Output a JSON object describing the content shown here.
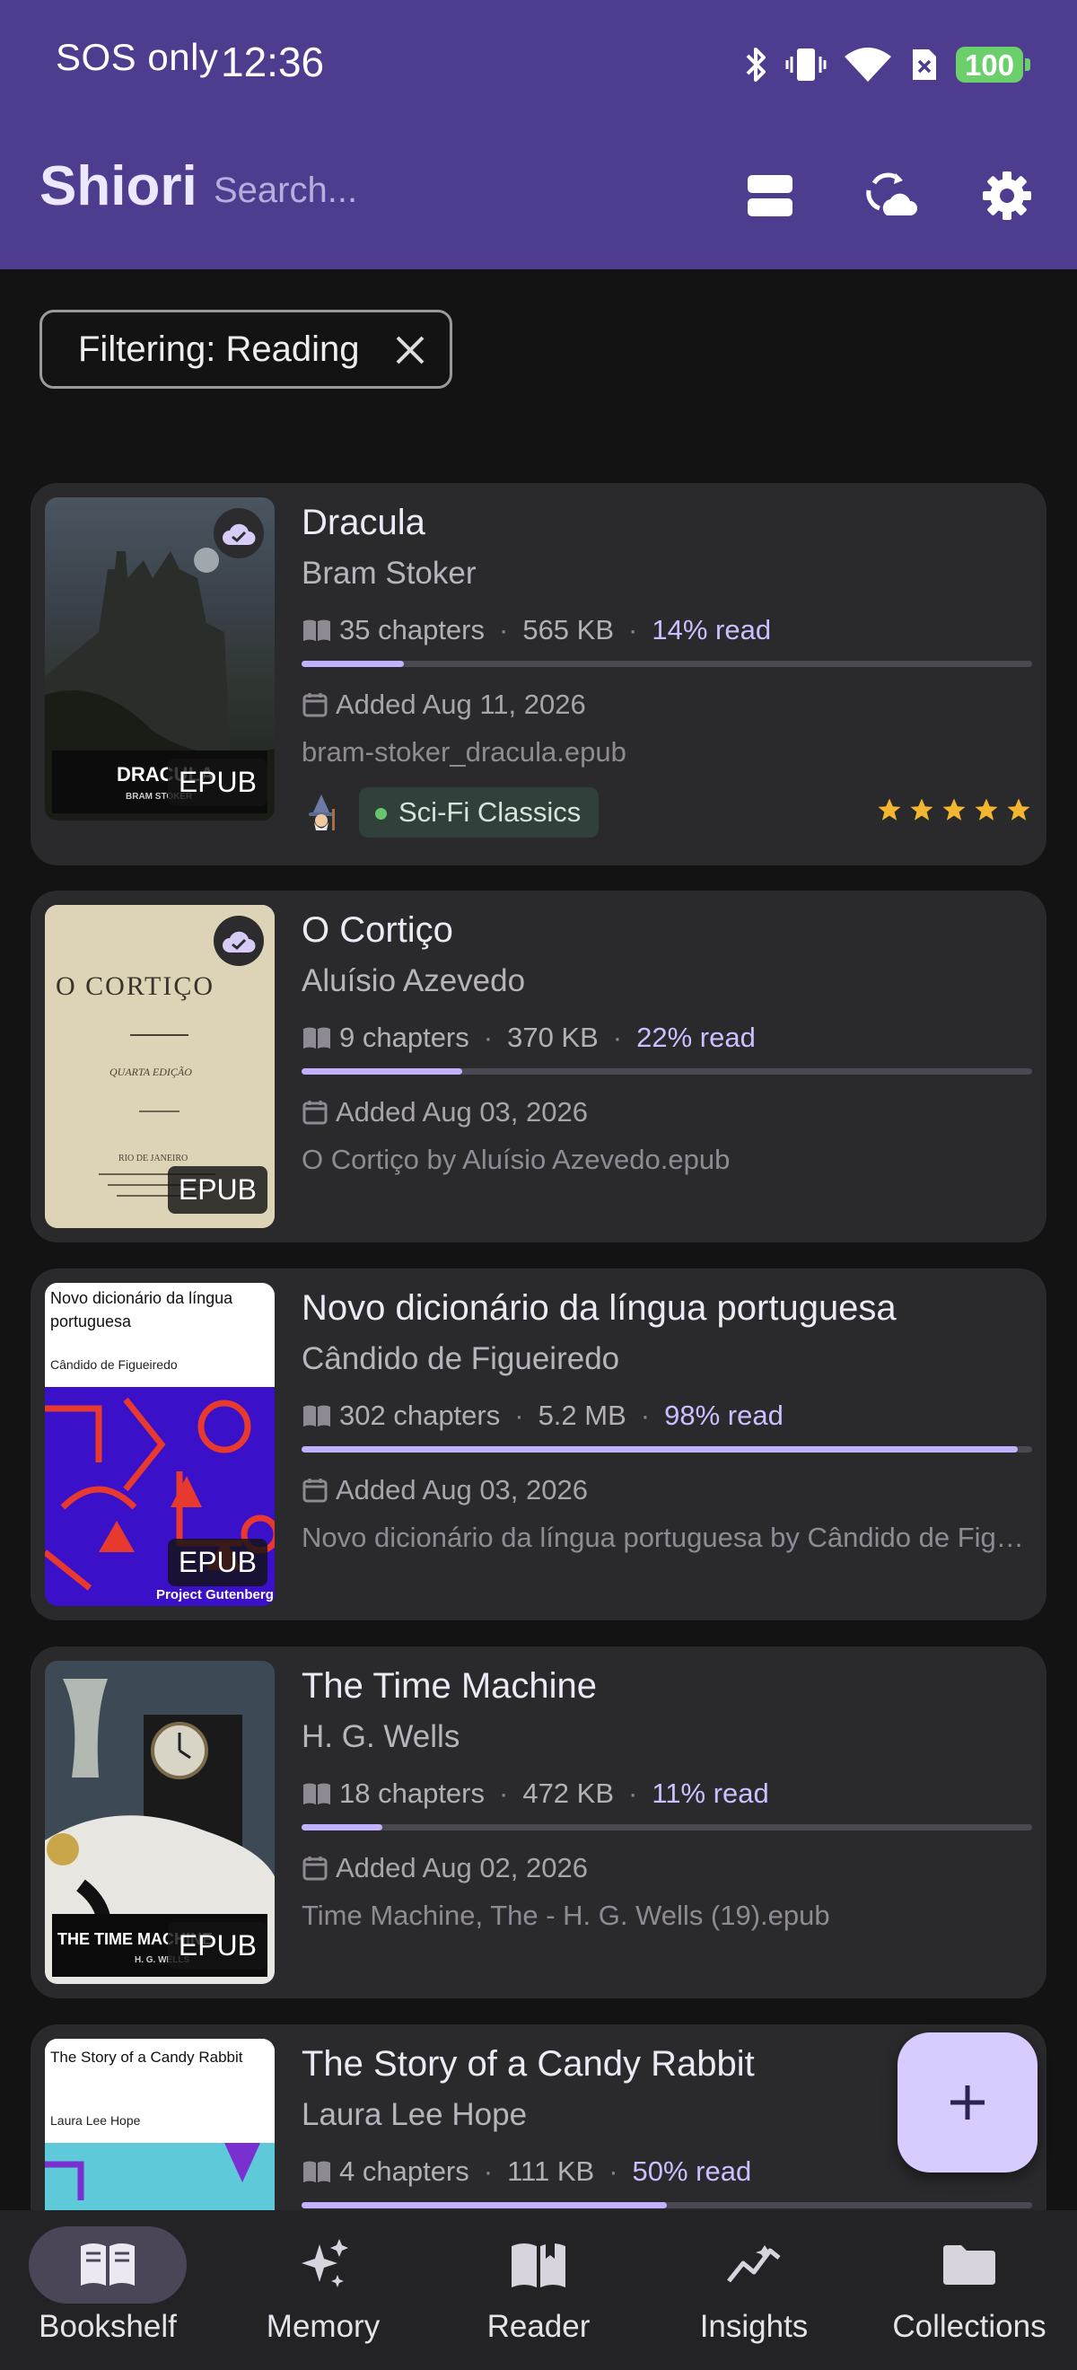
{
  "status": {
    "carrier": "SOS only",
    "time": "12:36",
    "battery": "100"
  },
  "appbar": {
    "title": "Shiori",
    "search_placeholder": "Search..."
  },
  "filter": {
    "label": "Filtering: Reading"
  },
  "books": [
    {
      "title": "Dracula",
      "author": "Bram Stoker",
      "chapters": "35 chapters",
      "size": "565 KB",
      "read": "14% read",
      "progress": 0.14,
      "added": "Added Aug 11, 2026",
      "file": "bram-stoker_dracula.epub",
      "format": "EPUB",
      "synced": true,
      "cover_title": "DRACULA",
      "cover_author": "BRAM STOKER",
      "tag": "Sci-Fi Classics",
      "rating": 5
    },
    {
      "title": "O Cortiço",
      "author": "Aluísio Azevedo",
      "chapters": "9 chapters",
      "size": "370 KB",
      "read": "22% read",
      "progress": 0.22,
      "added": "Added Aug 03, 2026",
      "file": "O Cortiço by Aluísio Azevedo.epub",
      "format": "EPUB",
      "synced": true,
      "cover_title": "O CORTIÇO",
      "cover_sub": "QUARTA EDIÇÃO",
      "cover_place": "RIO DE JANEIRO"
    },
    {
      "title": "Novo dicionário da língua portuguesa",
      "author": "Cândido de Figueiredo",
      "chapters": "302 chapters",
      "size": "5.2 MB",
      "read": "98% read",
      "progress": 0.98,
      "added": "Added Aug 03, 2026",
      "file": "Novo dicionário da língua portuguesa by Cândido de Figueiredo.epub",
      "format": "EPUB",
      "cover_title": "Novo dicionário da língua portuguesa",
      "cover_author": "Cândido de Figueiredo",
      "cover_publisher": "Project Gutenberg"
    },
    {
      "title": "The Time Machine",
      "author": "H. G. Wells",
      "chapters": "18 chapters",
      "size": "472 KB",
      "read": "11% read",
      "progress": 0.11,
      "added": "Added Aug 02, 2026",
      "file": "Time Machine, The - H. G. Wells (19).epub",
      "format": "EPUB",
      "cover_title": "THE TIME MACHINE",
      "cover_author": "H. G. WELLS"
    },
    {
      "title": "The Story of a Candy Rabbit",
      "author": "Laura Lee Hope",
      "chapters": "4 chapters",
      "size": "111 KB",
      "read": "50% read",
      "progress": 0.5,
      "cover_title": "The Story of a Candy Rabbit",
      "cover_author": "Laura Lee Hope"
    }
  ],
  "nav": [
    {
      "label": "Bookshelf",
      "icon": "book-open-icon",
      "active": true
    },
    {
      "label": "Memory",
      "icon": "sparkles-icon"
    },
    {
      "label": "Reader",
      "icon": "reader-book-icon"
    },
    {
      "label": "Insights",
      "icon": "chart-line-icon"
    },
    {
      "label": "Collections",
      "icon": "folder-icon"
    }
  ],
  "colors": {
    "appbar": "#4e3d8f",
    "background": "#131313",
    "card": "#2a2a2c",
    "accent": "#c3b1ff",
    "fab": "#d8ccff"
  }
}
